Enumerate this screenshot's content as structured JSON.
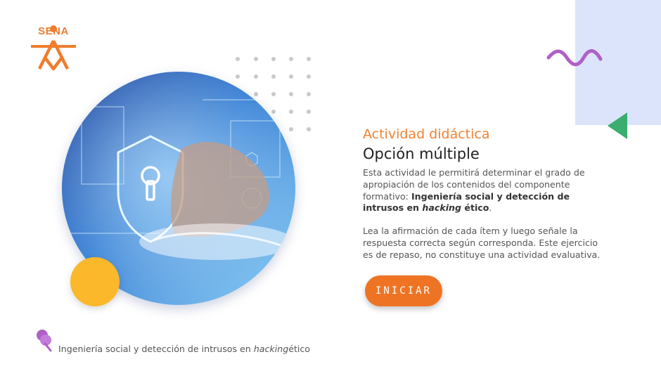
{
  "brand": {
    "logo_text": "SENA",
    "color": "#ef7d2c"
  },
  "activity": {
    "title": "Actividad didáctica",
    "subtitle": "Opción múltiple",
    "intro_text": "Esta actividad le permitirá determinar el grado de apropiación de los contenidos del componente formativo:",
    "topic_bold": "Ingeniería social y detección de intrusos en",
    "topic_italic": "hacking",
    "topic_end": "ético",
    "period": ".",
    "instructions": "Lea la afirmación de cada ítem y luego señale la respuesta correcta según corresponda.  Este ejercicio es de repaso, no constituye una actividad evaluativa."
  },
  "start_button": {
    "label": "INICIAR",
    "color": "#ee7424"
  },
  "footer": {
    "text_before": "Ingeniería social y detección de intrusos en",
    "text_italic": "hacking",
    "text_after": "ético",
    "icon": "pushpin-icon"
  },
  "decorations": {
    "hero_image": "cybersecurity-shield-image",
    "accent_orange": "#f08232",
    "accent_yellow": "#fbb82b",
    "accent_purple": "#b05fc8",
    "accent_green": "#3aae6e",
    "panel_blue": "#dbe4fb"
  }
}
